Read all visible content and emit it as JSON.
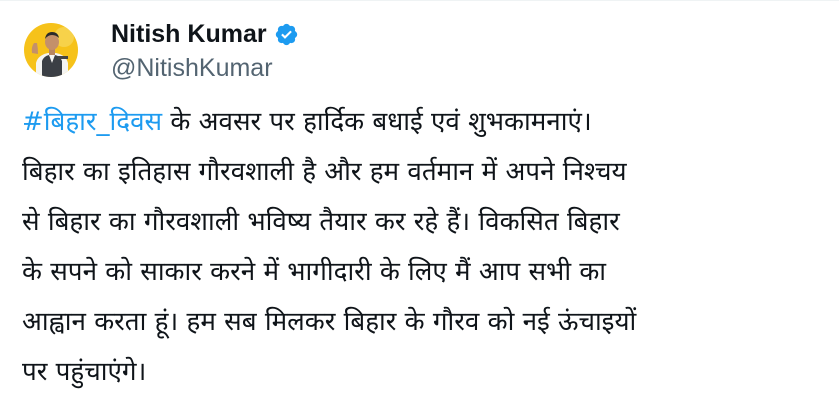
{
  "tweet": {
    "author": {
      "display_name": "Nitish Kumar",
      "handle": "@NitishKumar",
      "verified": true,
      "verified_icon": "verified-badge-icon",
      "avatar_bg": "#f6c21a"
    },
    "hashtag": "#बिहार_दिवस",
    "lines": [
      " के अवसर पर हार्दिक बधाई एवं शुभकामनाएं।",
      "बिहार का इतिहास गौरवशाली है और हम वर्तमान में अपने निश्चय",
      "से बिहार का गौरवशाली भविष्य तैयार कर रहे हैं। विकसित बिहार",
      "के सपने को साकार करने में भागीदारी के लिए मैं आप सभी का",
      "आह्वान करता हूं। हम सब मिलकर बिहार के गौरव को नई ऊंचाइयों",
      "पर पहुंचाएंगे।"
    ]
  },
  "colors": {
    "text": "#0f1419",
    "secondary": "#536471",
    "link": "#1d9bf0",
    "verified": "#1d9bf0"
  }
}
